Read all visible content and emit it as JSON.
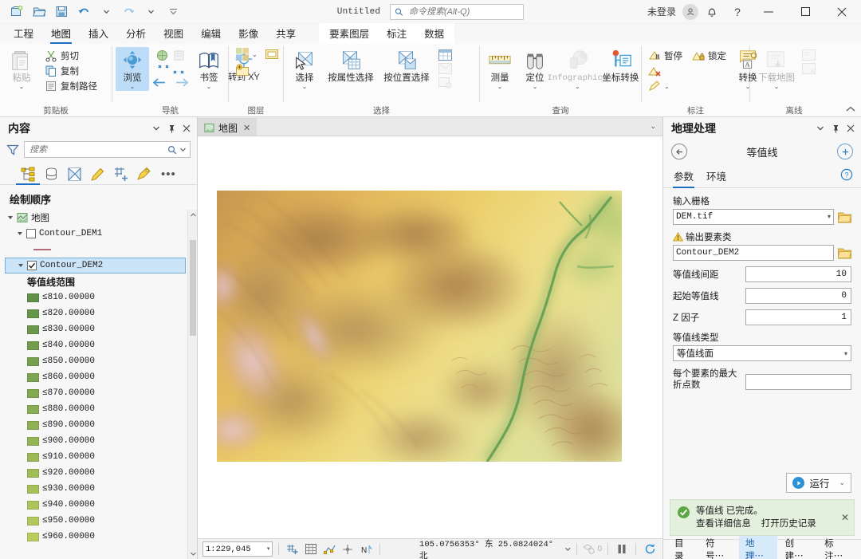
{
  "titlebar": {
    "doc_title": "Untitled",
    "search_placeholder": "命令搜索(Alt-Q)",
    "signin_label": "未登录",
    "quick_access": [
      {
        "name": "new-project-icon",
        "tip": "新建"
      },
      {
        "name": "open-project-icon",
        "tip": "打开"
      },
      {
        "name": "save-project-icon",
        "tip": "保存"
      },
      {
        "name": "undo-icon",
        "tip": "撤消"
      },
      {
        "name": "undo-dropdown-icon",
        "tip": "撤消下拉"
      },
      {
        "name": "redo-icon",
        "tip": "恢复"
      },
      {
        "name": "redo-dropdown-icon",
        "tip": "恢复下拉"
      },
      {
        "name": "customize-qat-icon",
        "tip": "自定义快速访问工具栏"
      }
    ],
    "window_buttons": {
      "minimize": "—",
      "maximize": "□",
      "close": "✕"
    },
    "help_glyph": "?"
  },
  "ribbon_tabs": {
    "items": [
      {
        "label": "工程",
        "active": false
      },
      {
        "label": "地图",
        "active": true
      },
      {
        "label": "插入",
        "active": false
      },
      {
        "label": "分析",
        "active": false
      },
      {
        "label": "视图",
        "active": false
      },
      {
        "label": "编辑",
        "active": false
      },
      {
        "label": "影像",
        "active": false
      },
      {
        "label": "共享",
        "active": false
      }
    ],
    "contextual": [
      {
        "label": "要素图层"
      },
      {
        "label": "标注"
      },
      {
        "label": "数据"
      }
    ]
  },
  "ribbon": {
    "groups": [
      {
        "name": "clipboard",
        "label": "剪贴板",
        "big": [
          {
            "label": "粘贴",
            "icon": "paste-icon",
            "caret": true,
            "disabled": true
          }
        ],
        "small": [
          {
            "label": "剪切",
            "icon": "cut-icon"
          },
          {
            "label": "复制",
            "icon": "copy-icon"
          },
          {
            "label": "复制路径",
            "icon": "copy-path-icon"
          }
        ]
      },
      {
        "name": "navigate",
        "label": "导航",
        "big": [
          {
            "label": "浏览",
            "icon": "explore-icon",
            "caret": true,
            "selected": true
          },
          {
            "label": "书签",
            "icon": "bookmarks-icon",
            "caret": true
          },
          {
            "label": "转到 XY",
            "icon": "go-to-xy-icon",
            "caret": false
          }
        ],
        "has_launcher": true
      },
      {
        "name": "layer",
        "label": "图层",
        "has_launcher": false
      },
      {
        "name": "selection",
        "label": "选择",
        "big": [
          {
            "label": "选择",
            "icon": "select-icon",
            "caret": true
          },
          {
            "label": "按属性选择",
            "icon": "select-by-attributes-icon",
            "caret": false
          },
          {
            "label": "按位置选择",
            "icon": "select-by-location-icon",
            "caret": false
          }
        ],
        "has_launcher": true
      },
      {
        "name": "inquiry",
        "label": "查询",
        "big": [
          {
            "label": "测量",
            "icon": "measure-icon",
            "caret": true
          },
          {
            "label": "定位",
            "icon": "locate-icon",
            "caret": true
          },
          {
            "label": "Infographics",
            "icon": "infographics-icon",
            "caret": true,
            "disabled": true
          },
          {
            "label": "坐标转换",
            "icon": "coordinate-conversion-icon",
            "caret": false
          }
        ]
      },
      {
        "name": "labeling",
        "label": "标注",
        "small": [
          {
            "label": "暂停",
            "icon": "pause-labeling-icon"
          },
          {
            "label": "锁定",
            "icon": "lock-labeling-icon"
          }
        ],
        "big": [
          {
            "label": "转换",
            "icon": "convert-labels-icon",
            "caret": true
          }
        ],
        "has_launcher": true
      },
      {
        "name": "offline",
        "label": "离线",
        "big": [
          {
            "label": "下载地图",
            "icon": "download-map-icon",
            "caret": true,
            "disabled": true
          }
        ],
        "has_launcher": true
      }
    ]
  },
  "contents": {
    "title": "内容",
    "search_placeholder": "搜索",
    "tabs": [
      {
        "name": "drawing-order-tab",
        "active": true
      },
      {
        "name": "data-source-tab",
        "active": false
      },
      {
        "name": "selection-tab",
        "active": false
      },
      {
        "name": "editing-tab",
        "active": false
      },
      {
        "name": "snapping-tab",
        "active": false
      },
      {
        "name": "labeling-tab",
        "active": false
      }
    ],
    "more_glyph": "•••",
    "section_label": "绘制顺序",
    "map_node": "地图",
    "layers": [
      {
        "name": "Contour_DEM1",
        "checked": false,
        "selected": false,
        "symbol": "line"
      },
      {
        "name": "Contour_DEM2",
        "checked": true,
        "selected": true,
        "symbol": "legend"
      }
    ],
    "legend_title": "等值线范围",
    "legend_items": [
      {
        "label": "≤810.00000",
        "color": "#5f9148"
      },
      {
        "label": "≤820.00000",
        "color": "#659549"
      },
      {
        "label": "≤830.00000",
        "color": "#6b994b"
      },
      {
        "label": "≤840.00000",
        "color": "#719d4c"
      },
      {
        "label": "≤850.00000",
        "color": "#77a14e"
      },
      {
        "label": "≤860.00000",
        "color": "#7da54f"
      },
      {
        "label": "≤870.00000",
        "color": "#83a951"
      },
      {
        "label": "≤880.00000",
        "color": "#89ad52"
      },
      {
        "label": "≤890.00000",
        "color": "#8fb154"
      },
      {
        "label": "≤900.00000",
        "color": "#95b555"
      },
      {
        "label": "≤910.00000",
        "color": "#9bb957"
      },
      {
        "label": "≤920.00000",
        "color": "#a1bd58"
      },
      {
        "label": "≤930.00000",
        "color": "#a7c15a"
      },
      {
        "label": "≤940.00000",
        "color": "#adc55b"
      },
      {
        "label": "≤950.00000",
        "color": "#b3c95d"
      },
      {
        "label": "≤960.00000",
        "color": "#b9cd5e"
      }
    ]
  },
  "map": {
    "tab_label": "地图",
    "tab_close_glyph": "✕",
    "dropdown_glyph": "⌄"
  },
  "statusbar": {
    "scale": "1:229,045",
    "coordinates": "105.0756353° 东 25.0824024° 北",
    "selected_count": "0",
    "buttons": [
      {
        "name": "add-data-status-icon"
      },
      {
        "name": "grid-status-icon"
      },
      {
        "name": "snapping-status-icon"
      },
      {
        "name": "crosshair-status-icon"
      },
      {
        "name": "north-status-icon"
      }
    ],
    "pause_glyph": "❙❙",
    "refresh_glyph": "⟳"
  },
  "geoprocessing": {
    "title": "地理处理",
    "tool_title": "等值线",
    "back_glyph": "←",
    "add_glyph": "+",
    "tabs": [
      {
        "label": "参数",
        "active": true
      },
      {
        "label": "环境",
        "active": false
      }
    ],
    "help_glyph": "?",
    "fields": {
      "input_raster_label": "输入栅格",
      "input_raster_value": "DEM.tif",
      "output_features_label": "输出要素类",
      "output_features_value": "Contour_DEM2",
      "output_warning": true,
      "contour_interval_label": "等值线间距",
      "contour_interval_value": "10",
      "base_contour_label": "起始等值线",
      "base_contour_value": "0",
      "z_factor_label": "Z 因子",
      "z_factor_value": "1",
      "contour_type_label": "等值线类型",
      "contour_type_value": "等值线面",
      "max_vertices_label": "每个要素的最大折点数",
      "max_vertices_value": ""
    },
    "run_label": "运行",
    "run_caret": "⌄",
    "notification": {
      "title": "等值线  已完成。",
      "link_details": "查看详细信息",
      "link_history": "打开历史记录",
      "close_glyph": "✕"
    },
    "bottom_tabs": [
      {
        "label": "目录",
        "active": false
      },
      {
        "label": "符号⋯",
        "active": false
      },
      {
        "label": "地理⋯",
        "active": true
      },
      {
        "label": "创建⋯",
        "active": false
      },
      {
        "label": "标注⋯",
        "active": false
      }
    ]
  },
  "colors": {
    "accent": "#1b6ec2",
    "selection": "#cce4f7",
    "success_bg": "#e3f0dd",
    "success_icon": "#5aa744"
  }
}
